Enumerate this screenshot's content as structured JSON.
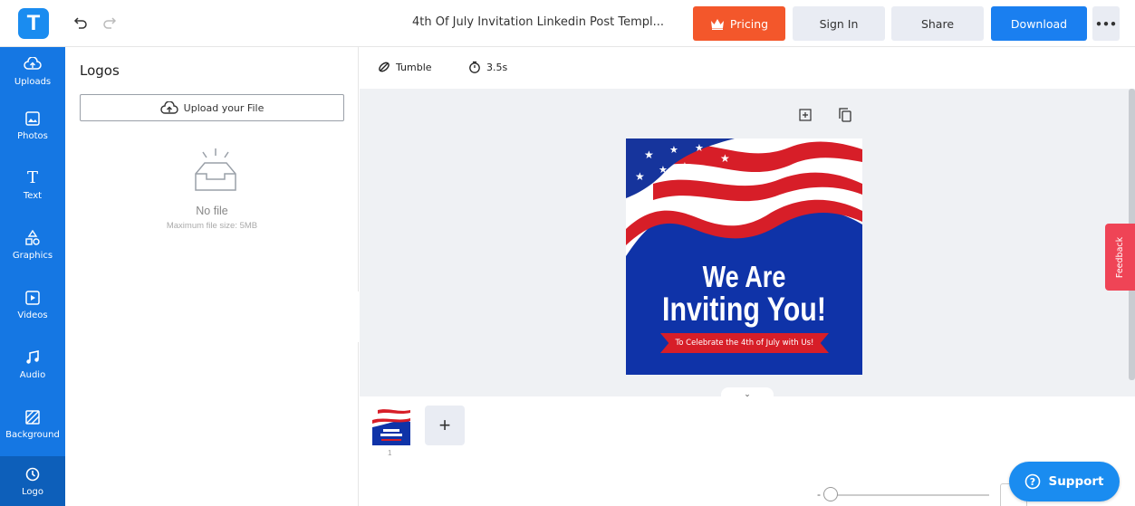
{
  "app": {
    "logo_letter": "T",
    "document_title": "4th Of July Invitation Linkedin Post Templ...",
    "accent_color": "#1577e3"
  },
  "header": {
    "pricing_label": "Pricing",
    "signin_label": "Sign In",
    "share_label": "Share",
    "download_label": "Download",
    "more_label": "•••"
  },
  "sidebar": {
    "items": [
      {
        "label": "Uploads",
        "icon": "cloud-upload-icon"
      },
      {
        "label": "Photos",
        "icon": "image-icon"
      },
      {
        "label": "Text",
        "icon": "text-icon"
      },
      {
        "label": "Graphics",
        "icon": "shapes-icon"
      },
      {
        "label": "Videos",
        "icon": "video-icon"
      },
      {
        "label": "Audio",
        "icon": "music-icon"
      },
      {
        "label": "Background",
        "icon": "background-icon"
      },
      {
        "label": "Logo",
        "icon": "logo-icon"
      }
    ],
    "active": "Logo"
  },
  "panel": {
    "title": "Logos",
    "upload_label": "Upload your File",
    "empty_text": "No file",
    "max_size_text": "Maximum file size: 5MB"
  },
  "toolbar": {
    "animation_label": "Tumble",
    "duration_label": "3.5s"
  },
  "design": {
    "headline_line1": "We Are",
    "headline_line2": "Inviting You!",
    "ribbon_text": "To Celebrate the 4th of July with Us!"
  },
  "timeline": {
    "page_number": "1",
    "add_label": "+"
  },
  "feedback_label": "Feedback",
  "support_label": "Support"
}
